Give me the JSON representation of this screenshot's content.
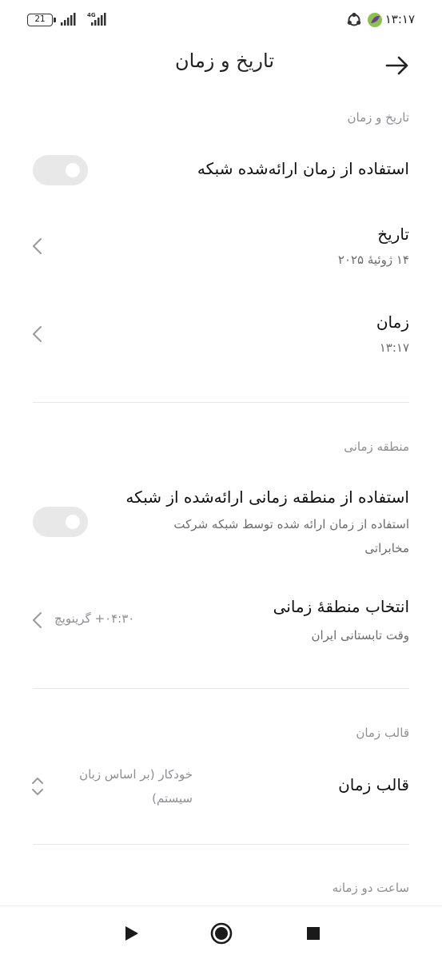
{
  "status_bar": {
    "battery_level": "21",
    "network_type": "4G",
    "time": "۱۳:۱۷"
  },
  "header": {
    "title": "تاریخ و زمان",
    "back_icon": "arrow-right-icon"
  },
  "sections": {
    "date_time": {
      "label": "تاریخ و زمان",
      "use_network_time": {
        "title": "استفاده از زمان ارائه‌شده شبکه",
        "enabled": false
      },
      "date": {
        "title": "تاریخ",
        "value": "۱۴ ژوئیهٔ ۲۰۲۵"
      },
      "time": {
        "title": "زمان",
        "value": "۱۳:۱۷"
      }
    },
    "time_zone": {
      "label": "منطقه زمانی",
      "use_network_zone": {
        "title": "استفاده از منطقه زمانی ارائه‌شده از شبکه",
        "subtitle": "استفاده از زمان ارائه شده توسط شبکه شرکت مخابراتی",
        "enabled": false
      },
      "select_zone": {
        "title": "انتخاب منطقهٔ زمانی",
        "subtitle": "وقت تابستانی ایران",
        "value": "‎+۰۴:۳۰ گرینویچ"
      }
    },
    "time_format": {
      "label": "قالب زمان",
      "format": {
        "title": "قالب زمان",
        "value": "خودکار (بر اساس زبان سیستم)"
      }
    },
    "dual_clock": {
      "label": "ساعت دو زمانه"
    }
  },
  "nav_bar": {
    "back_icon": "play-triangle-icon",
    "home_icon": "home-circle-icon",
    "recents_icon": "recents-square-icon"
  }
}
